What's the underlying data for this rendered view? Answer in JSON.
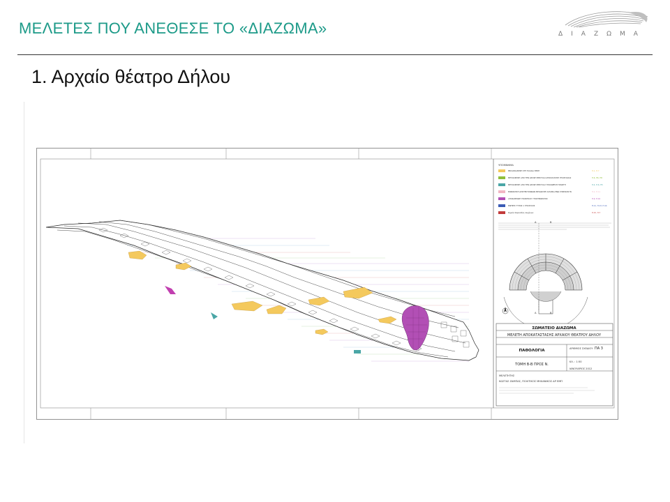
{
  "header": {
    "title": "ΜΕΛΕΤΕΣ ΠΟΥ ΑΝΕΘΕΣΕ ΤΟ «ΔΙΑΖΩΜΑ»",
    "logo_text": "ΔΙΑΖΩΜΑ"
  },
  "slide": {
    "heading": "1. Αρχαίο θέατρο Δήλου"
  },
  "drawing": {
    "colors": {
      "accent": "#1c9a88",
      "yellow_fill": "#f4c95d",
      "magenta_fill": "#b24fb5",
      "line_purple": "#6b4fa0"
    },
    "legend": {
      "title": "ΥΠΟΜΝΗΜΑ",
      "items": [
        {
          "label": "ΒΕΛΑΣΙΚΑΝΗΣΗ ΣΤΗ ΠΑΛΑΙΑ ΘΕΣΗ",
          "color": "#f4c95d",
          "code": "Π.1, Π.7"
        },
        {
          "label": "ΜΕΤΑΚΙΝΗΣΗ ΑΠΟ ΤΗΝ ΑΡΧΙΚΗ ΘΕΣΗ ΚΑΙ ΑΠΟΚΟΛΛΗΣΗ ΥΠΟΣΤΑΣΙΑΣ",
          "color": "#8fbf3a",
          "code": "Π.6, Π6, Π8"
        },
        {
          "label": "ΜΕΤΑΚΙΝΗΣΗ ΑΠΟ ΤΗΝ ΑΡΧΙΚΗ ΘΕΣΗ ΚΑΙ ΥΠΟΧΩΡΗΣΗ ΓΡΑΝΙΤΗ",
          "color": "#4aa6a6",
          "code": "Π.4, Π.6, Π5"
        },
        {
          "label": "ΕΝΝΟΙΚΗΣΗ ΑΡΧΙΤΕΚΤΟΝΙΚΩΝ ΜΕΛΩΝ ΜΕ ΧΑΤΑΜΙΑ ΕΝΩ ΣΥΝΕΧΙΖΟΥΝ",
          "color": "#f2b6c4",
          "code": "Π.2, Π.11"
        },
        {
          "label": "ΑΠΟΣΑΘΡΩΣΗ ΓΡΑΝΙΤΙΚΟΥ ΥΠΟΣΤΡΩΜΑΤΟΣ",
          "color": "#b24fb5",
          "code": "Π.9, Π.10"
        },
        {
          "label": "ΡΩΓΜΗΣ ΤΥΠΟΣ 1 ΥΠΟΣΤΑΣΙΣ",
          "color": "#3b5bb5",
          "code": "Π.11, Π.13, Π.14"
        },
        {
          "label": "Σημεία παρουσίας λειχήνων",
          "color": "#c23b3b",
          "code": "Π.15, Π.7"
        }
      ]
    },
    "title_block": {
      "org": "ΣΩΜΑΤΕΙΟ ΔΙΑΖΩΜΑ",
      "study": "ΜΕΛΕΤΗ ΑΠΟΚΑΤΑΣΤΑΣΗΣ ΑΡΧΑΙΟΥ ΘΕΑΤΡΟΥ ΔΗΛΟΥ",
      "subject": "ΠΑΘΟΛΟΓΙΑ",
      "section": "ΤΟΜΗ Β-Β ΠΡΟΣ Ν.",
      "drawing_no_label": "ΑΡΙΘΜΟΣ ΣΧΕΔΙΟΥ",
      "drawing_no": "ΠΑ 3",
      "scale": "ΚΛ. : 1:50",
      "date": "ΙΑΝΟΥΑΡΙΟΣ 2012",
      "author_label": "ΜΕΛΕΤΗΤΗΣ",
      "author": "ΚΩΣΤΑΣ ΖΑΜΠΑΣ, ΠΟΛΙΤΙΚΟΣ ΜΗΧΑΝΙΚΟΣ ΔΡ ΕΜΠ"
    },
    "plan": {
      "section_a_label": "Α",
      "section_b_label": "Β"
    }
  }
}
